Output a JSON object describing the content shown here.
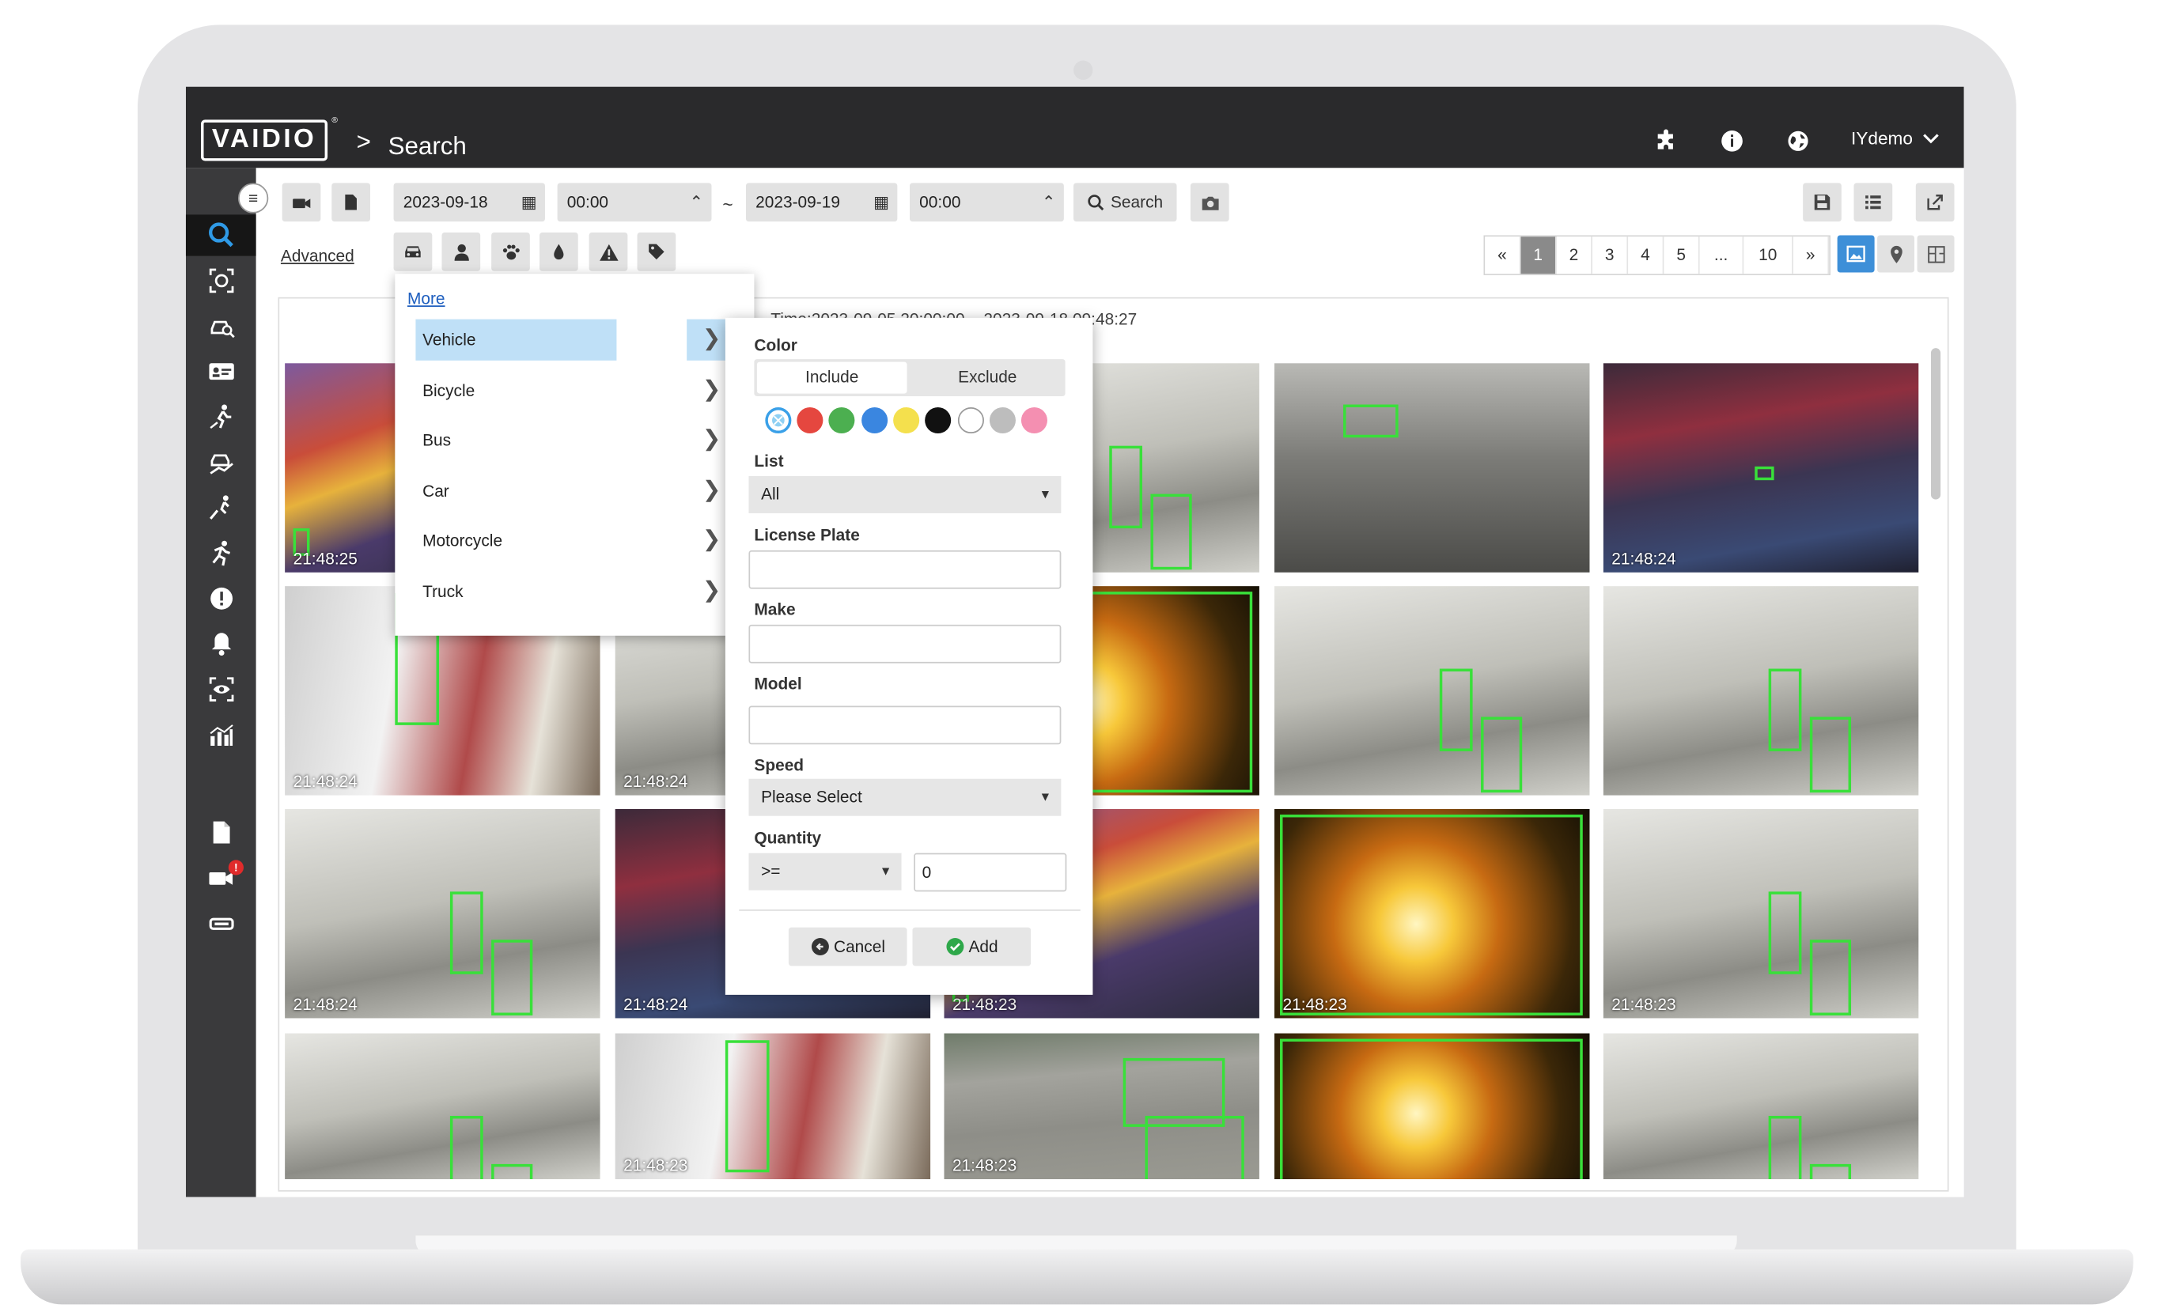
{
  "app": {
    "logo_text": "VAIDIO",
    "logo_mark": "®",
    "breadcrumb_sep": ">",
    "page_title": "Search",
    "user": "IYdemo"
  },
  "toolbar": {
    "start_date": "2023-09-18",
    "start_time": "00:00",
    "range_sep": "~",
    "end_date": "2023-09-19",
    "end_time": "00:00",
    "search_label": "Search",
    "advanced_label": "Advanced"
  },
  "pagination": {
    "prev": "«",
    "pages": [
      "1",
      "2",
      "3",
      "4",
      "5",
      "...",
      "10"
    ],
    "next": "»",
    "current": "1"
  },
  "summary": {
    "text": "Time:2023-09-05 20:00:00 ~ 2023-09-18 09:48:27"
  },
  "vehicle_menu": {
    "more_label": "More",
    "items": [
      "Vehicle",
      "Bicycle",
      "Bus",
      "Car",
      "Motorcycle",
      "Truck"
    ],
    "selected": "Vehicle"
  },
  "attributes": {
    "color_label": "Color",
    "include_label": "Include",
    "exclude_label": "Exclude",
    "colors": [
      "#e5473f",
      "#4caf50",
      "#3a86e0",
      "#f4e04d",
      "#111111",
      "#ffffff",
      "#bdbdbd",
      "#f48fb1"
    ],
    "list_label": "List",
    "list_value": "All",
    "plate_label": "License Plate",
    "plate_value": "",
    "make_label": "Make",
    "make_value": "",
    "model_label": "Model",
    "model_value": "",
    "speed_label": "Speed",
    "speed_value": "Please Select",
    "quantity_label": "Quantity",
    "quantity_op": ">=",
    "quantity_value": "0",
    "cancel_label": "Cancel",
    "add_label": "Add"
  },
  "results": [
    {
      "time": "21:48:25",
      "scene": "billboard"
    },
    {
      "time": "",
      "scene": "fire"
    },
    {
      "time": "",
      "scene": "hall"
    },
    {
      "time": "",
      "scene": "street"
    },
    {
      "time": "21:48:24",
      "scene": "square"
    },
    {
      "time": "21:48:24",
      "scene": "store"
    },
    {
      "time": "21:48:24",
      "scene": "hall"
    },
    {
      "time": "21:48:24",
      "scene": "fire"
    },
    {
      "time": "",
      "scene": "hall"
    },
    {
      "time": "",
      "scene": "hall"
    },
    {
      "time": "21:48:24",
      "scene": "hall"
    },
    {
      "time": "21:48:24",
      "scene": "square"
    },
    {
      "time": "21:48:23",
      "scene": "billboard"
    },
    {
      "time": "21:48:23",
      "scene": "fire"
    },
    {
      "time": "21:48:23",
      "scene": "hall"
    },
    {
      "time": "",
      "scene": "hall"
    },
    {
      "time": "21:48:23",
      "scene": "store"
    },
    {
      "time": "21:48:23",
      "scene": "parking"
    },
    {
      "time": "",
      "scene": "fire"
    },
    {
      "time": "",
      "scene": "hall"
    },
    {
      "time": "",
      "scene": "hall"
    },
    {
      "time": "",
      "scene": "hall"
    },
    {
      "time": "",
      "scene": "square"
    },
    {
      "time": "",
      "scene": "parking"
    }
  ]
}
